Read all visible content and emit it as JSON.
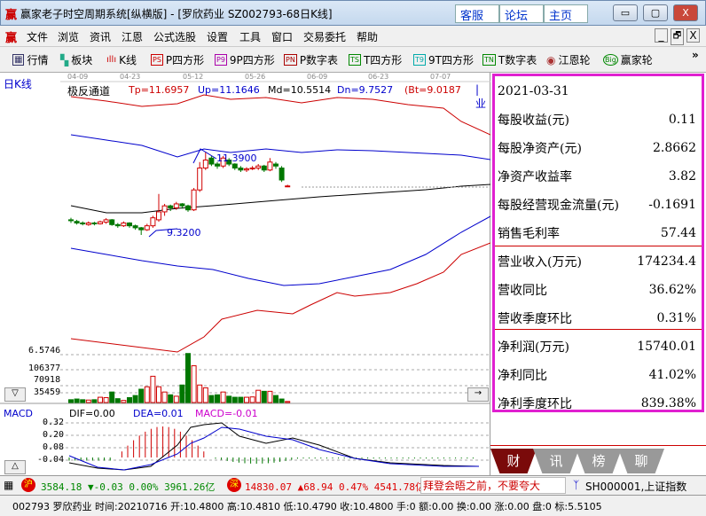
{
  "window": {
    "title": "赢家老子时空周期系统[纵横版] - [罗欣药业  SZ002793-68日K线]",
    "links": [
      "客服",
      "论坛",
      "主页"
    ],
    "controls": [
      "▭",
      "▢",
      "X"
    ]
  },
  "menu": {
    "items": [
      "文件",
      "浏览",
      "资讯",
      "江恩",
      "公式选股",
      "设置",
      "工具",
      "窗口",
      "交易委托",
      "帮助"
    ],
    "mdi": [
      "_",
      "🗗",
      "X"
    ]
  },
  "toolbar": {
    "items": [
      {
        "icon": "grid",
        "label": "行情"
      },
      {
        "icon": "blocks",
        "label": "板块"
      },
      {
        "icon": "kline",
        "label": "K线"
      },
      {
        "icon": "PS",
        "label": "P四方形"
      },
      {
        "icon": "P9",
        "label": "9P四方形"
      },
      {
        "icon": "PN",
        "label": "P数字表"
      },
      {
        "icon": "TS",
        "label": "T四方形"
      },
      {
        "icon": "T9",
        "label": "9T四方形"
      },
      {
        "icon": "TN",
        "label": "T数字表"
      },
      {
        "icon": "wheel",
        "label": "江恩轮"
      },
      {
        "icon": "Big",
        "label": "赢家轮"
      }
    ],
    "more": "»"
  },
  "chart": {
    "period_label": "日K线",
    "dates": [
      "04-09",
      "04-23",
      "05-12",
      "05-26",
      "06-09",
      "06-23",
      "07-07"
    ],
    "indicator": {
      "name": "极反通道",
      "tp": "Tp=11.6957",
      "up": "Up=11.1646",
      "md": "Md=10.5514",
      "dn": "Dn=9.7527",
      "bt": "(Bt=9.0187",
      "extra": "|业"
    },
    "high_label": "11.3900",
    "low_label": "9.3200",
    "bottom_price": "6.5746",
    "vol_ticks": [
      "106377",
      "70918",
      "35459"
    ],
    "candles": [
      [
        9.7,
        9.75,
        9.62,
        9.68
      ],
      [
        9.66,
        9.7,
        9.58,
        9.62
      ],
      [
        9.62,
        9.66,
        9.56,
        9.6
      ],
      [
        9.58,
        9.66,
        9.55,
        9.62
      ],
      [
        9.62,
        9.65,
        9.56,
        9.6
      ],
      [
        9.6,
        9.68,
        9.58,
        9.65
      ],
      [
        9.64,
        9.74,
        9.6,
        9.7
      ],
      [
        9.7,
        9.72,
        9.55,
        9.58
      ],
      [
        9.58,
        9.62,
        9.5,
        9.55
      ],
      [
        9.55,
        9.66,
        9.52,
        9.62
      ],
      [
        9.62,
        9.64,
        9.5,
        9.55
      ],
      [
        9.55,
        9.58,
        9.45,
        9.5
      ],
      [
        9.5,
        9.52,
        9.32,
        9.45
      ],
      [
        9.45,
        9.6,
        9.42,
        9.55
      ],
      [
        9.55,
        9.8,
        9.5,
        9.75
      ],
      [
        9.7,
        10.35,
        9.65,
        9.9
      ],
      [
        9.9,
        10.1,
        9.8,
        10.05
      ],
      [
        10.05,
        10.08,
        9.92,
        10.0
      ],
      [
        10.0,
        10.15,
        9.95,
        10.1
      ],
      [
        10.1,
        10.12,
        9.98,
        10.05
      ],
      [
        10.05,
        10.08,
        9.9,
        9.95
      ],
      [
        9.95,
        10.5,
        9.92,
        10.45
      ],
      [
        10.45,
        11.15,
        10.4,
        11.0
      ],
      [
        11.0,
        11.39,
        10.95,
        11.2
      ],
      [
        11.25,
        11.3,
        11.05,
        11.1
      ],
      [
        11.1,
        11.15,
        10.98,
        11.05
      ],
      [
        11.05,
        11.3,
        11.0,
        11.25
      ],
      [
        11.2,
        11.25,
        11.05,
        11.1
      ],
      [
        11.1,
        11.12,
        10.95,
        11.0
      ],
      [
        11.0,
        11.05,
        10.9,
        10.95
      ],
      [
        10.95,
        11.02,
        10.9,
        10.98
      ],
      [
        10.98,
        11.05,
        10.95,
        11.0
      ],
      [
        11.0,
        11.1,
        10.95,
        11.05
      ],
      [
        11.05,
        11.08,
        10.9,
        10.95
      ],
      [
        10.95,
        11.25,
        10.92,
        11.15
      ],
      [
        11.1,
        11.15,
        10.98,
        11.05
      ],
      [
        11.0,
        11.05,
        10.65,
        10.7
      ],
      [
        10.55,
        10.58,
        10.52,
        10.55
      ]
    ],
    "volumes": [
      8000,
      10000,
      8000,
      7000,
      8000,
      15000,
      14000,
      30000,
      11000,
      6000,
      14000,
      20000,
      38000,
      45000,
      75000,
      45000,
      30000,
      22000,
      18000,
      50000,
      140000,
      105000,
      50000,
      42000,
      20000,
      22000,
      30000,
      18000,
      15000,
      15000,
      15000,
      16000,
      35000,
      32000,
      32000,
      20000,
      10000,
      3000
    ],
    "macd": {
      "name": "MACD",
      "dif": "DIF=0.00",
      "dea": "DEA=0.01",
      "macd": "MACD=-0.01",
      "ticks": [
        "0.32",
        "0.20",
        "0.08",
        "-0.04"
      ]
    },
    "buttons": {
      "down": "▽",
      "up": "△",
      "right": "→"
    }
  },
  "panel": {
    "date": "2021-03-31",
    "rows": [
      [
        "每股收益(元)",
        "0.11"
      ],
      [
        "每股净资产(元)",
        "2.8662"
      ],
      [
        "净资产收益率",
        "3.82"
      ],
      [
        "每股经营现金流量(元)",
        "-0.1691"
      ],
      [
        "销售毛利率",
        "57.44"
      ],
      [
        "营业收入(万元)",
        "174234.4"
      ],
      [
        "营收同比",
        "36.62%"
      ],
      [
        "营收季度环比",
        "0.31%"
      ],
      [
        "净利润(万元)",
        "15740.01"
      ],
      [
        "净利同比",
        "41.02%"
      ],
      [
        "净利季度环比",
        "839.38%"
      ]
    ],
    "tabs": [
      "财",
      "讯",
      "榜",
      "聊"
    ]
  },
  "status": {
    "sh_badge": "沪",
    "sh": "3584.18 ▼-0.03 0.00% 3961.26亿",
    "sz_badge": "深",
    "sz": "14830.07 ▲68.94 0.47% 4541.78亿",
    "news": "拜登会晤之前，不要夸大",
    "index": "SH000001,上证指数",
    "quote": "002793 罗欣药业 时间:20210716 开:10.4800 高:10.4810 低:10.4790 收:10.4800 手:0 额:0.00 换:0.00 涨:0.00 盘:0 标:5.5105"
  },
  "colors": {
    "up": "#d00000",
    "down": "#007700",
    "accent": "#e020d0"
  }
}
